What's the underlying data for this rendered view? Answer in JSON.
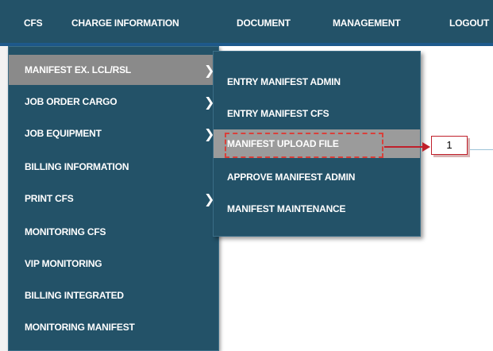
{
  "top_nav": {
    "items": [
      "CFS",
      "CHARGE INFORMATION",
      "DOCUMENT",
      "MANAGEMENT",
      "LOGOUT"
    ]
  },
  "cfs_menu": {
    "items": [
      {
        "label": "MANIFEST EX. LCL/RSL",
        "has_submenu": true,
        "active": true
      },
      {
        "label": "JOB ORDER CARGO",
        "has_submenu": true
      },
      {
        "label": "JOB EQUIPMENT",
        "has_submenu": true
      },
      {
        "label": "BILLING INFORMATION",
        "has_submenu": false
      },
      {
        "label": "PRINT CFS",
        "has_submenu": true
      },
      {
        "label": "MONITORING CFS",
        "has_submenu": false
      },
      {
        "label": "VIP MONITORING",
        "has_submenu": false
      },
      {
        "label": "BILLING INTEGRATED",
        "has_submenu": false
      },
      {
        "label": "MONITORING MANIFEST",
        "has_submenu": false
      }
    ]
  },
  "manifest_submenu": {
    "items": [
      {
        "label": "ENTRY MANIFEST ADMIN"
      },
      {
        "label": "ENTRY MANIFEST CFS"
      },
      {
        "label": "MANIFEST UPLOAD FILE",
        "highlighted": true
      },
      {
        "label": "APPROVE MANIFEST ADMIN"
      },
      {
        "label": "MANIFEST MAINTENANCE"
      }
    ]
  },
  "annotation": {
    "number": "1"
  },
  "icons": {
    "submenu_arrow": "chevron-right-icon"
  },
  "colors": {
    "menu_bg": "#235268",
    "active_bg": "#8a8a8a",
    "highlight_bg": "#9b9b9b",
    "callout_red": "#c0202b"
  }
}
